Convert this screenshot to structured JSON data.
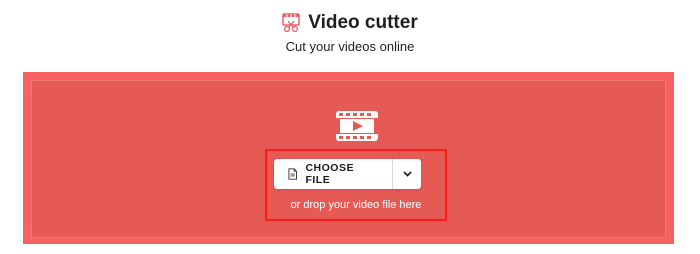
{
  "header": {
    "title": "Video cutter",
    "subtitle": "Cut your videos online",
    "icon": "video-cutter-icon"
  },
  "dropzone": {
    "icon": "film-play-icon",
    "choose_file_label": "CHOOSE FILE",
    "file_icon": "file-icon",
    "dropdown_icon": "chevron-down-icon",
    "drop_text": "or drop your video file here"
  },
  "colors": {
    "dropzone_outer": "#f66262",
    "dropzone_inner": "#e65a56",
    "highlight": "#ff1a1a",
    "accent_icon": "#e8626a"
  }
}
